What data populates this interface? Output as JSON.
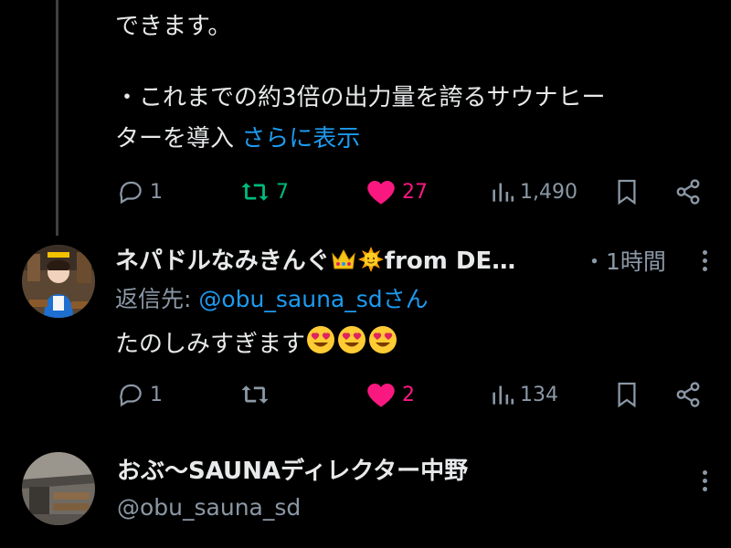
{
  "tweet1": {
    "top_line_fragment": "できます。",
    "bullet_line1": "・これまでの約3倍の出力量を誇るサウナヒー",
    "bullet_line2": "ターを導入",
    "show_more": "さらに表示",
    "actions": {
      "replies": "1",
      "retweets": "7",
      "likes": "27",
      "views": "1,490"
    }
  },
  "tweet2": {
    "display_name": "ネパドルなみきんぐ",
    "display_name_suffix": "from DE…",
    "time": "・1時間",
    "reply_prefix": "返信先: ",
    "reply_handle": "@obu_sauna_sdさん",
    "text": "たのしみすぎます",
    "actions": {
      "replies": "1",
      "retweets": "",
      "likes": "2",
      "views": "134"
    }
  },
  "tweet3": {
    "display_name": "おぶ〜SAUNAディレクター中野",
    "handle": "@obu_sauna_sd"
  },
  "icons": [
    "reply-icon",
    "retweet-icon",
    "like-icon",
    "views-icon",
    "bookmark-icon",
    "share-icon",
    "more-icon",
    "crown-emoji",
    "sun-emoji",
    "heart-eyes-emoji"
  ],
  "colors": {
    "background": "#000000",
    "text": "#e7e9ea",
    "muted": "#8b98a5",
    "link": "#1d9bf0",
    "retweet_active": "#00ba7c",
    "like_active": "#f91880"
  }
}
